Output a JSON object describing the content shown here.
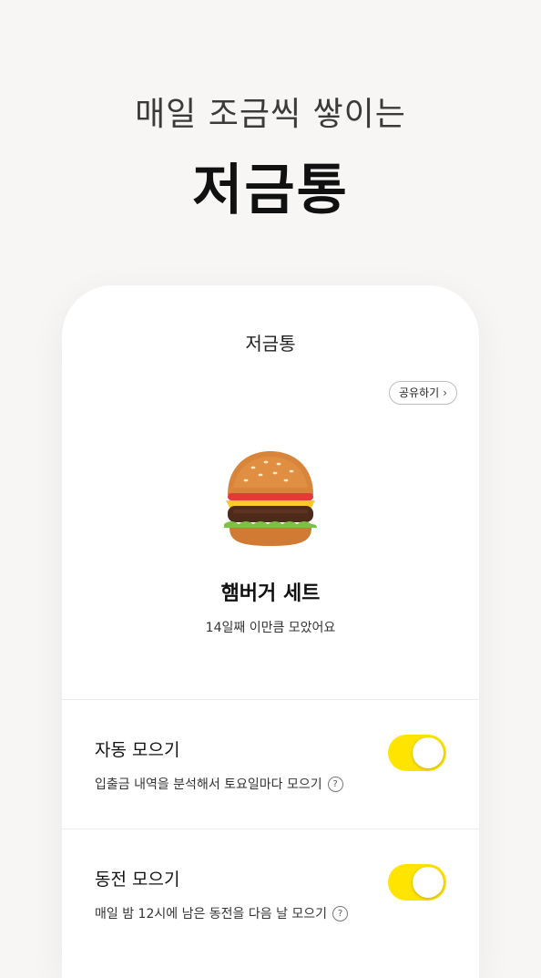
{
  "promo": {
    "headline": "매일 조금씩 쌓이는",
    "title": "저금통"
  },
  "screen": {
    "title": "저금통",
    "share_label": "공유하기",
    "item_name": "햄버거 세트",
    "item_subtitle": "14일째 이만큼 모았어요",
    "item_icon": "hamburger-emoji"
  },
  "settings": [
    {
      "title": "자동 모으기",
      "description": "입출금 내역을 분석해서 토요일마다 모으기",
      "enabled": true
    },
    {
      "title": "동전 모으기",
      "description": "매일 밤 12시에 남은 동전을 다음 날 모으기",
      "enabled": true
    }
  ],
  "colors": {
    "accent": "#ffe400",
    "background": "#f7f6f4"
  }
}
